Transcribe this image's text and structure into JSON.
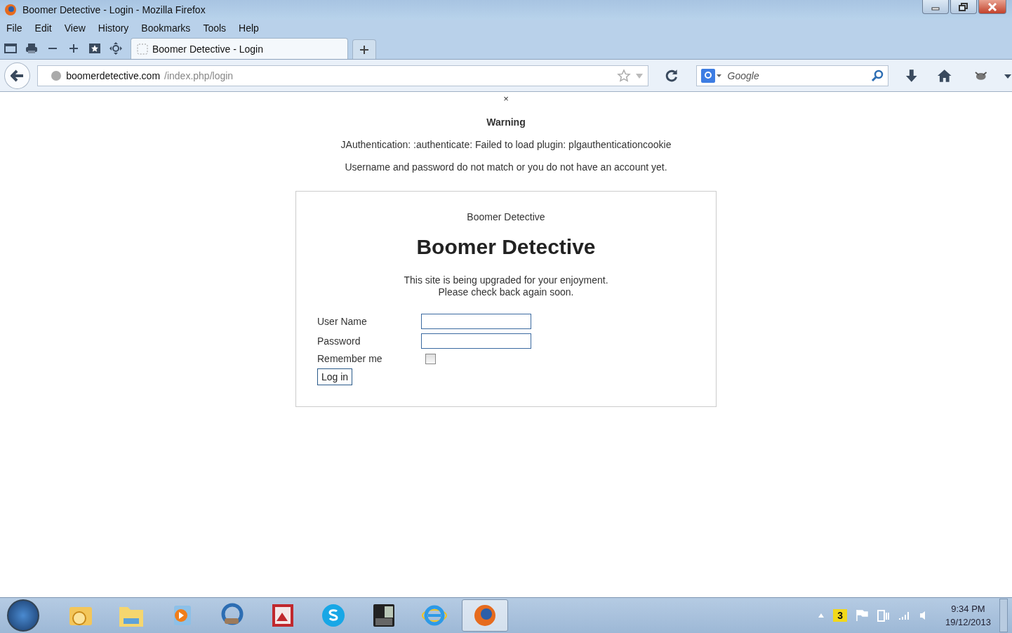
{
  "window": {
    "title": "Boomer Detective - Login - Mozilla Firefox"
  },
  "menu": [
    "File",
    "Edit",
    "View",
    "History",
    "Bookmarks",
    "Tools",
    "Help"
  ],
  "tabs": [
    {
      "label": "Boomer Detective - Login",
      "selected": true
    }
  ],
  "address_bar": {
    "domain": "boomerdetective.com",
    "path": "/index.php/login"
  },
  "search": {
    "placeholder": "Google"
  },
  "page": {
    "close_mark": "×",
    "warning_title": "Warning",
    "messages": [
      "JAuthentication: :authenticate: Failed to load plugin: plgauthenticationcookie",
      "Username and password do not match or you do not have an account yet."
    ],
    "login": {
      "site_name": "Boomer Detective",
      "heading": "Boomer Detective",
      "description": [
        "This site is being upgraded for your enjoyment.",
        "Please check back again soon."
      ],
      "fields": [
        {
          "label": "User Name"
        },
        {
          "label": "Password"
        }
      ],
      "remember": {
        "label": "Remember me",
        "checked": false
      },
      "button": "Log in"
    }
  },
  "taskbar": {
    "apps": [
      {
        "kind": "mail",
        "selected": false
      },
      {
        "kind": "folder",
        "selected": false
      },
      {
        "kind": "media",
        "selected": false
      },
      {
        "kind": "sync",
        "selected": false
      },
      {
        "kind": "picture",
        "selected": false
      },
      {
        "kind": "skype",
        "selected": false
      },
      {
        "kind": "calculator",
        "selected": false
      },
      {
        "kind": "ie",
        "selected": false
      },
      {
        "kind": "firefox",
        "selected": true
      }
    ],
    "badge": "3",
    "time": "9:34 PM",
    "date": "19/12/2013"
  }
}
